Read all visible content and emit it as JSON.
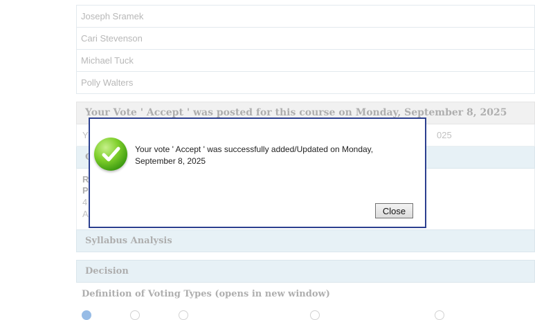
{
  "committee": {
    "names": [
      "Joseph Sramek",
      "Cari Stevenson",
      "Michael Tuck",
      "Polly Walters"
    ]
  },
  "vote_section": {
    "header": "Your Vote ' Accept ' was posted for this course on Monday, September 8, 2025",
    "row_prefix": "Y",
    "row_suffix": "025"
  },
  "partial_rows": {
    "c_row": "C",
    "r_label": "R",
    "p_label": "P",
    "line_4": "4",
    "line_a": "A"
  },
  "sections": {
    "syllabus": "Syllabus Analysis",
    "decision": "Decision",
    "definition": "Definition of Voting Types (opens in new window)"
  },
  "modal": {
    "message": "Your vote ' Accept ' was successfully added/Updated on Monday, September 8, 2025",
    "close_label": "Close",
    "icon": "success-check-icon"
  },
  "colors": {
    "modal_border": "#2b3f8f",
    "section_blue": "#d3e6ef",
    "header_gray": "#e6e6e6"
  }
}
